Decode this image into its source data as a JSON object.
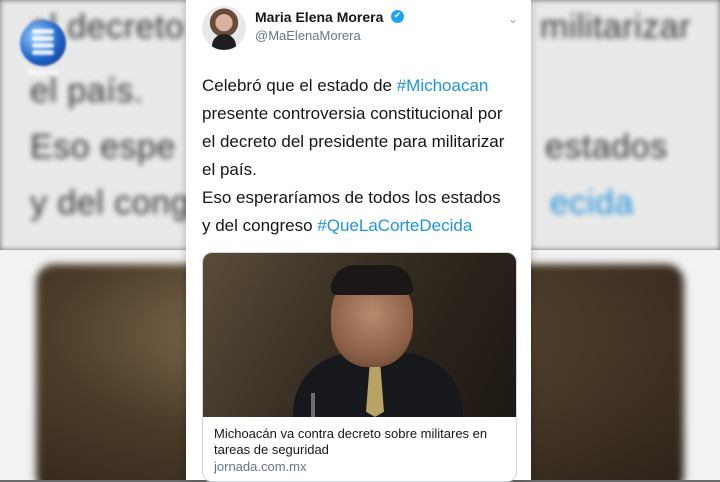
{
  "background": {
    "lines": [
      {
        "text": "el decreto",
        "tail": "militarizar",
        "hashtag": ""
      },
      {
        "text": "el país.",
        "tail": "",
        "hashtag": ""
      },
      {
        "text": "Eso espe",
        "tail": "estados",
        "hashtag": ""
      },
      {
        "text": "y del cong",
        "tail": "",
        "hashtag": "ecida"
      }
    ]
  },
  "logo": {
    "label": "Noticias"
  },
  "tweet": {
    "author_name": "Maria Elena Morera",
    "author_handle": "@MaElenaMorera",
    "verified_icon": "✔",
    "menu_icon": "⌄",
    "text_lines": [
      {
        "before": "Celebró que el estado de ",
        "hashtag": "#Michoacan",
        "after": ""
      },
      {
        "before": "presente controversia constitucional por",
        "hashtag": "",
        "after": ""
      },
      {
        "before": "el decreto del presidente para militarizar",
        "hashtag": "",
        "after": ""
      },
      {
        "before": "el país.",
        "hashtag": "",
        "after": ""
      },
      {
        "before": "Eso esperaríamos de todos los estados",
        "hashtag": "",
        "after": ""
      },
      {
        "before": "y del congreso ",
        "hashtag": "#QueLaCorteDecida",
        "after": ""
      }
    ],
    "link_card": {
      "title": "Michoacán va contra decreto sobre militares en tareas de seguridad",
      "domain": "jornada.com.mx"
    }
  },
  "colors": {
    "hashtag": "#1b95e0",
    "verified": "#1da1f2",
    "text": "#14171a",
    "muted": "#657786"
  }
}
